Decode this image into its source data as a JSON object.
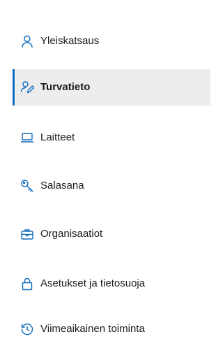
{
  "accent_color": "#0f6cbd",
  "icon_color": "#0f6cbd",
  "selected_item": "Turvatieto",
  "nav": {
    "items": [
      {
        "label": "Yleiskatsaus",
        "icon": "person-icon"
      },
      {
        "label": "Turvatieto",
        "icon": "person-key-icon"
      },
      {
        "label": "Laitteet",
        "icon": "laptop-icon"
      },
      {
        "label": "Salasana",
        "icon": "key-icon"
      },
      {
        "label": "Organisaatiot",
        "icon": "briefcase-icon"
      },
      {
        "label": "Asetukset ja tietosuoja",
        "icon": "lock-icon"
      },
      {
        "label": "Viimeaikainen toiminta",
        "icon": "history-icon"
      }
    ]
  }
}
